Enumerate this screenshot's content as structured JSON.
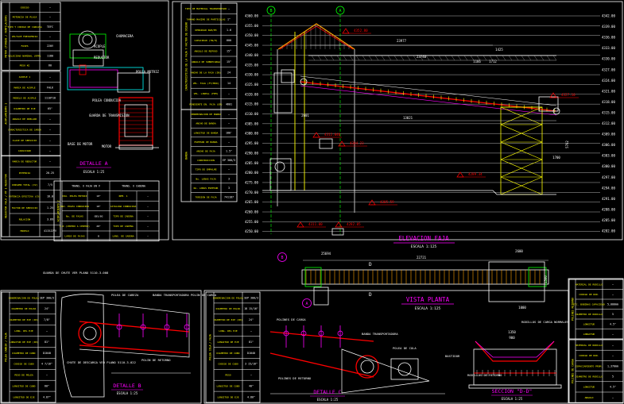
{
  "colors": {
    "bg": "#000000",
    "frame": "#ffffff",
    "yellow": "#ffff00",
    "red": "#ff0000",
    "green": "#00ff00",
    "magenta": "#ff00ff",
    "cyan": "#00ffff",
    "blue": "#0000ff",
    "pink": "#ff3f7f",
    "orange": "#ff9f00",
    "grey": "#9f9f9f"
  },
  "elev_labels": [
    "4360.00",
    "4355.00",
    "4350.00",
    "4345.00",
    "4340.00",
    "4335.00",
    "4330.00",
    "4325.00",
    "4320.00",
    "4315.00",
    "4310.00",
    "4305.00",
    "4300.00",
    "4295.00",
    "4290.00",
    "4285.00",
    "4280.00",
    "4275.00",
    "4270.00",
    "4265.00",
    "4260.00",
    "4255.00",
    "4250.00"
  ],
  "right_elev_labels": [
    "4342.00",
    "4339.00",
    "4336.00",
    "4333.00",
    "4330.00",
    "4327.00",
    "4324.00",
    "4321.00",
    "4318.00",
    "4315.00",
    "4312.00",
    "4309.00",
    "4306.00",
    "4303.00",
    "4300.00",
    "4297.00",
    "4294.00",
    "4291.00",
    "4288.00",
    "4285.00",
    "4282.00"
  ],
  "elevacion": {
    "title": "ELEVACION FAJA",
    "scale": "ESCALA 1:125",
    "dims": [
      "23977",
      "1425",
      "1166",
      "1712",
      "13021",
      "2601",
      "5702",
      "23740",
      "1700"
    ],
    "grid_markers": [
      "B",
      "A"
    ],
    "levels": [
      "4352.80",
      "4327.10",
      "4312.040",
      "4304.23",
      "4305.59",
      "4311.00",
      "4289.34",
      "4282.05"
    ]
  },
  "vista_planta": {
    "title": "VISTA PLANTA",
    "scale": "ESCALA 1:125",
    "dims": [
      "22721",
      "25694",
      "2600",
      "1500",
      "1000"
    ],
    "cut": "D",
    "markers": [
      "B",
      "A"
    ]
  },
  "detalle_a": {
    "title": "DETALLE A",
    "scale": "ESCALA 1:25",
    "labels": [
      "CHUMACERA",
      "ACOPLE",
      "REDUCTOR",
      "POLEA MOTRIZ",
      "POLEA CONDUCIDA",
      "GUARDA DE TRANSMISION",
      "BASE DE MOTOR",
      "MOTOR"
    ]
  },
  "detalle_b": {
    "title": "DETALLE B",
    "scale": "ESCALA 1:25",
    "labels": [
      "GUARDA DE CHUTE VER PLANO 5110-3-008",
      "POLEA DE CABEZA",
      "BANDA TRANSPORTADORA",
      "POLIN DE CARGA",
      "POLIN DE RETORNO",
      "CHUTE DE DESCARGA VER PLANO 5110-3-022"
    ]
  },
  "detalle_c": {
    "title": "DETALLE C",
    "scale": "ESCALA 1:25",
    "labels": [
      "POLINES DE CARGA",
      "BANDA TRANSPORTADORA",
      "POLEA DE COLA",
      "POLINES DE RETORNO"
    ]
  },
  "seccion_dd": {
    "title": "SECCION \"D-D\"",
    "scale": "ESCALA 1:25",
    "labels": [
      "RODILLOS DE CARGA NORMALES",
      "BASTIDOR",
      "RODILLOS DE RETORNO"
    ],
    "dims": [
      "1350",
      "900"
    ]
  },
  "tables": {
    "motor": {
      "group": "MOTOR   (TORQUE / VENTILACION)",
      "rows": [
        [
          "CODIGO",
          "—"
        ],
        [
          "POTENCIA DE PLACA",
          "—"
        ],
        [
          "TIPO Y CODIGO DE CARCASA",
          "TEFC"
        ],
        [
          "VOLTAJE FRECUENCIA",
          "—"
        ],
        [
          "FASES",
          "220V"
        ],
        [
          "VELOCIDAD NOMINAL (RPM)",
          "1180"
        ],
        [
          "PESO KG",
          "60"
        ]
      ]
    },
    "acople1": {
      "group": "ACOPLAMIENTO 1",
      "rows": [
        [
          "ACOPLE 1",
          "—"
        ],
        [
          "MARCA DE ACOPLE",
          "FALK"
        ],
        [
          "MODELO DE ACOPLE",
          "1110T10"
        ],
        [
          "DIAMETRO DE EJE",
          "65\""
        ],
        [
          "ANGULO DE DOBLADO",
          "—"
        ],
        [
          "CARACTERISTICA DE CARGA",
          "—"
        ],
        [
          "CLASE DE SERVICIO",
          "—"
        ],
        [
          "CAPACIDAD",
          "—"
        ]
      ]
    },
    "reductor": {
      "group": "REDUCTOR  FALK  / MT 1 REDUCTOR",
      "rows": [
        [
          "MARCA DE REDUCTOR",
          "—"
        ],
        [
          "POTENCIA",
          "20.25"
        ],
        [
          "CONSUMO TOTAL (CV)",
          "7/5"
        ],
        [
          "POTENCIA EFECTIVA (CV)",
          "16.0"
        ],
        [
          "FACTOR DE SERVICIO",
          "1.25"
        ],
        [
          "RELACION",
          "3.69"
        ],
        [
          "MODELO",
          "4115J2VV"
        ]
      ]
    },
    "acople2": {
      "group": "ACOPLAMIENTO 2",
      "headers": [
        "TRANS. X FAJA EN V",
        "TRANS. X CADENA"
      ],
      "rows": [
        [
          "DIA. POLEA MOTRIZ",
          "10\"",
          "RPM. 1",
          "—"
        ],
        [
          "DIA. POLEA CONDUCIDA",
          "18\"",
          "CATALINA CONDUCIDA",
          "—"
        ],
        [
          "No. DE FAJAS",
          "GB5/8G",
          "TIPO DE CADENA",
          "—"
        ],
        [
          "C-D (CENTRO A CENTRO)",
          "28\"",
          "TIPO DE CADENA",
          "—"
        ],
        [
          "LARGO DE FAJAS",
          "B",
          "LONG. DE CADENA",
          "—"
        ]
      ]
    },
    "faja": {
      "group": "CARACTERISTICAS DE LA FAJA Y FACTOR DE DISENO",
      "rows": [
        [
          "TIPO DE MATERIAL TRANSPORTADO",
          "—"
        ],
        [
          "TAMANO MAXIMO DE PARTICULAS",
          "1\""
        ],
        [
          "DENSIDAD KGM/M3",
          "1.6"
        ],
        [
          "CAPACIDAD (TN/H)",
          "600"
        ],
        [
          "ANGULO DE REPOSO",
          "15°"
        ],
        [
          "ANGULO DE SOBRECARGA",
          "15°"
        ],
        [
          "ANCHO DE LA FAJA (IN)",
          "24"
        ],
        [
          "VEL. FAJA (FT/MIN)",
          "14"
        ],
        [
          "VEL. LINEAL (FPM)",
          "—"
        ],
        [
          "PENDIENTE EN. FAJA (GR)",
          "4601"
        ]
      ]
    },
    "banda": {
      "group": "BANDA",
      "rows": [
        [
          "DENOMINACION DE BANDA",
          "—"
        ],
        [
          "ANCHO DE BANDA",
          "—"
        ],
        [
          "LONGITUD DE BANDA",
          "180'"
        ],
        [
          "ESPESOR DE BANDA",
          "—"
        ],
        [
          "ANCHO DE FAJA",
          "1.5\""
        ],
        [
          "CONSTRUCCION",
          "EP 300/3"
        ],
        [
          "TIPO DE EMPALME",
          "—"
        ],
        [
          "No. LONAS FAJA",
          "3"
        ],
        [
          "No. LONAS ESPESOR",
          "3"
        ],
        [
          "TORSION DE FAJA",
          "741187"
        ]
      ]
    },
    "polea_cabeza": {
      "group": "POLEA CABEZA / FAJA",
      "rows": [
        [
          "DENOMINACION DE POLEA",
          "SEP 300/3"
        ],
        [
          "DIAMETRO DE POLEA",
          "24\""
        ],
        [
          "DIAMETRO DE EJE (IN)",
          "7/8\""
        ],
        [
          "LONG. DEL EJE",
          "—"
        ],
        [
          "LONGITUD DE EJE (IN)",
          "81\""
        ],
        [
          "DIAMETRO DE CUBO",
          "D1040"
        ],
        [
          "CODIGO DE CUBO",
          "4 7/16\""
        ],
        [
          "PESO DE POLEA",
          "—"
        ],
        [
          "LONGITUD DE CUBO",
          "60\""
        ],
        [
          "LONGITUD DE EJE",
          "4.87\""
        ]
      ]
    },
    "polea_cola": {
      "group": "POLEA COLA / FAJA",
      "rows": [
        [
          "DENOMINACION DE POLEA",
          "SEP 300/3"
        ],
        [
          "DIAMETRO DE POLEA",
          "18 15/16\""
        ],
        [
          "DIAMETRO DE EJE (IN)",
          "24\""
        ],
        [
          "LONG. DEL EJE",
          "—"
        ],
        [
          "LONGITUD DE EJE",
          "81\""
        ],
        [
          "DIAMETRO DE CUBO",
          "D1040"
        ],
        [
          "CODIGO DE CUBO",
          "3 15/16\""
        ],
        [
          "PESO",
          "—"
        ],
        [
          "LONGITUD DE CUBO",
          "40\""
        ],
        [
          "LONGITUD DE EJE",
          "4.80\""
        ]
      ]
    },
    "polines_retorno": {
      "group": "POLINES RETORNO",
      "rows": [
        [
          "MATERIAL DE RODILLO",
          "—"
        ],
        [
          "CODIGO DE ROD.",
          "—"
        ],
        [
          "ETC. BOBINAS CAPACIDAD",
          "5,000mm"
        ],
        [
          "DIAMETRO DE RODILLO",
          "5"
        ],
        [
          "LONGITUD",
          "4.5\""
        ],
        [
          "LONGITUD",
          "—"
        ]
      ]
    },
    "polines_carga": {
      "group": "POLINES DE CARGA",
      "rows": [
        [
          "MATERIAL DE RODILLO",
          "—"
        ],
        [
          "CODIGO DE ROD.",
          "—"
        ],
        [
          "ESPACIAMIENTO PROM.",
          "1,370mm"
        ],
        [
          "DIAMETRO DE RODILLO",
          "5"
        ],
        [
          "LONGITUD",
          "4.5\""
        ],
        [
          "ANGULO",
          "—"
        ]
      ]
    }
  }
}
